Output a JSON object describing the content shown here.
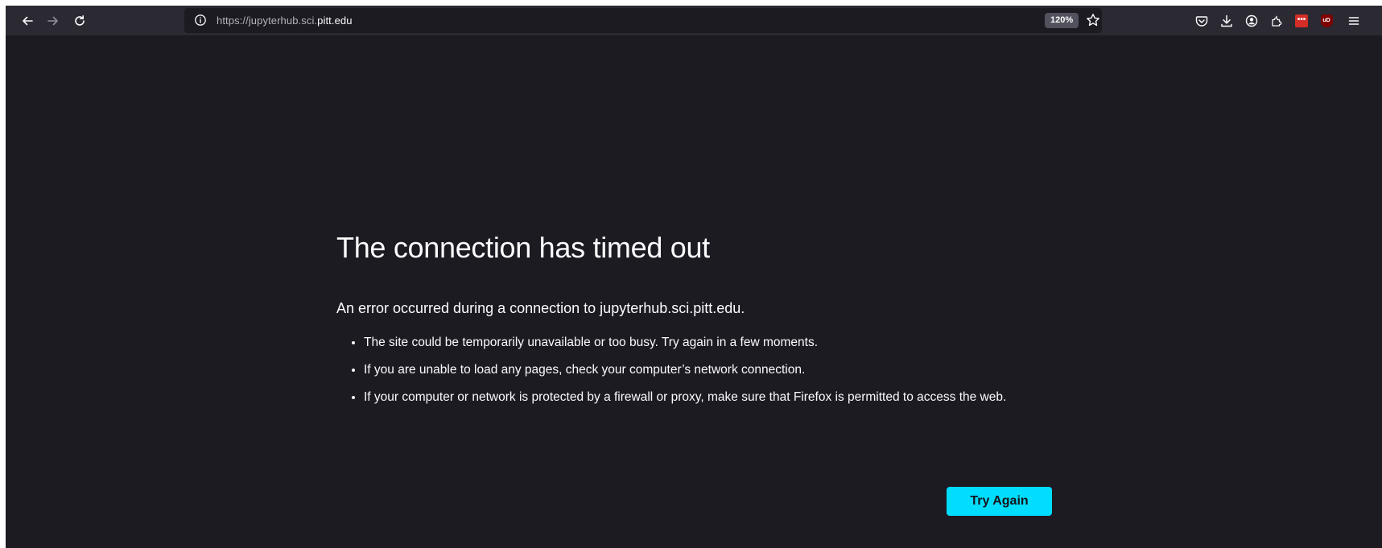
{
  "toolbar": {
    "back_icon": "arrow-left-icon",
    "forward_icon": "arrow-right-icon",
    "reload_icon": "reload-icon",
    "url_prefix": "https://jupyterhub.sci.",
    "url_domain": "pitt.edu",
    "zoom_level": "120%",
    "right_icons": [
      "pocket-icon",
      "download-icon",
      "account-icon",
      "extensions-icon",
      "lastpass-icon",
      "ublock-icon",
      "menu-icon"
    ],
    "lastpass_label": "•••",
    "ublock_label": "uD"
  },
  "error_page": {
    "title": "The connection has timed out",
    "subtitle": "An error occurred during a connection to jupyterhub.sci.pitt.edu.",
    "bullets": [
      "The site could be temporarily unavailable or too busy. Try again in a few moments.",
      "If you are unable to load any pages, check your computer’s network connection.",
      "If your computer or network is protected by a firewall or proxy, make sure that Firefox is permitted to access the web."
    ],
    "try_again_label": "Try Again"
  },
  "colors": {
    "page_bg": "#1c1b22",
    "toolbar_bg": "#2b2a33",
    "text": "#fbfbfe",
    "accent": "#00ddff",
    "lastpass_red": "#d32d27",
    "ublock_red": "#800000"
  }
}
